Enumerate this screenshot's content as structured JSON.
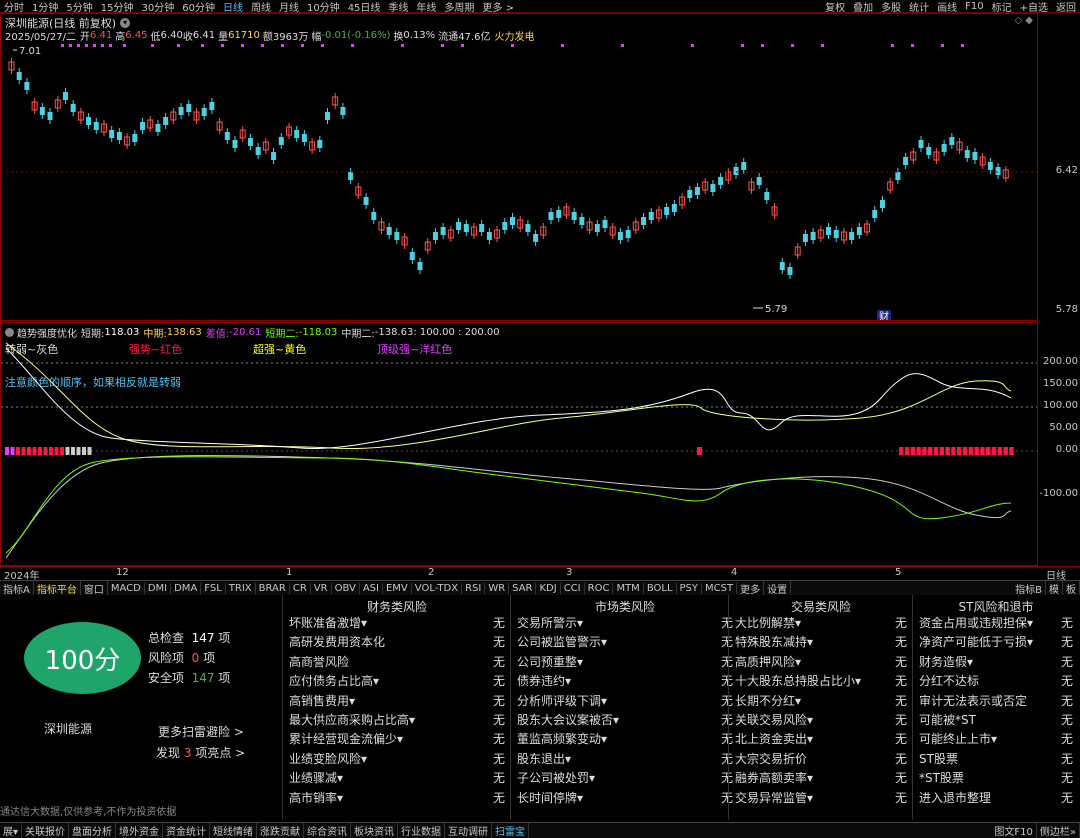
{
  "toolbar": {
    "periods": [
      "分时",
      "1分钟",
      "5分钟",
      "15分钟",
      "30分钟",
      "60分钟",
      "日线",
      "周线",
      "月线",
      "10分钟",
      "45日线",
      "季线",
      "年线",
      "多周期",
      "更多 >"
    ],
    "active_period": "日线",
    "right_items": [
      "复权",
      "叠加",
      "多股",
      "统计",
      "画线",
      "F10",
      "标记",
      "+自选",
      "返回"
    ]
  },
  "header": {
    "title": "深圳能源(日线 前复权)",
    "date": "2025/05/27/二",
    "open_label": "开",
    "open": "6.41",
    "high_label": "高",
    "high": "6.45",
    "low_label": "低",
    "low": "6.40",
    "close_label": "收",
    "close": "6.41",
    "vol_label": "量",
    "vol": "61710",
    "amt_label": "额",
    "amt": "3963万",
    "chg_label": "幅",
    "chg": "-0.01(-0.16%)",
    "turn_label": "换",
    "turn": "0.13%",
    "float_label": "流通",
    "float": "47.6亿",
    "concept": "火力发电"
  },
  "price_axis": {
    "high": "7.01",
    "mid": "6.42",
    "low": "5.78",
    "min_marker": "5.79",
    "fin_marker": "财"
  },
  "indicator": {
    "name": "趋势强度优化",
    "short_label": "短期:",
    "short": "118.03",
    "mid_label": "中期:",
    "mid": "138.63",
    "diff_label": "差值:",
    "diff": "-20.61",
    "short2_label": "短期二:",
    "short2": "-118.03",
    "mid2_label": "中期二:",
    "mid2": "-138.63",
    "refs": ": 100.00 : 200.00",
    "legend": [
      "转弱~灰色",
      "强势~红色",
      "超强~黄色",
      "顶级强~洋红色"
    ],
    "note": "注意颜色的顺序，如果相反就是转弱",
    "axis": [
      "200.00",
      "150.00",
      "100.00",
      "50.00",
      "0.00",
      "-100.00"
    ]
  },
  "time_axis": [
    "2024年",
    "12",
    "1",
    "2",
    "3",
    "4",
    "5"
  ],
  "time_axis_right": "日线",
  "tabs": [
    "指标A",
    "指标平台",
    "窗口",
    "MACD",
    "DMI",
    "DMA",
    "FSL",
    "TRIX",
    "BRAR",
    "CR",
    "VR",
    "OBV",
    "ASI",
    "EMV",
    "VOL-TDX",
    "RSI",
    "WR",
    "SAR",
    "KDJ",
    "CCI",
    "ROC",
    "MTM",
    "BOLL",
    "PSY",
    "MCST",
    "更多",
    "设置"
  ],
  "tabs_right": [
    "指标B",
    "模",
    "板"
  ],
  "risk": {
    "score": "100分",
    "stock": "深圳能源",
    "total_label": "总检查",
    "total": "147",
    "unit": "项",
    "risk_label": "风险项",
    "risk": "0",
    "safe_label": "安全项",
    "safe": "147",
    "more": "更多扫雷避险 >",
    "found_prefix": "发现",
    "found": "3",
    "found_suffix": "项亮点 >",
    "disclaimer": "通达信大数据,仅供参考,不作为投资依据",
    "categories": [
      {
        "title": "财务类风险",
        "items": [
          "坏账准备激增▾",
          "高研发费用资本化",
          "高商誉风险",
          "应付债务占比高▾",
          "高销售费用▾",
          "最大供应商采购占比高▾",
          "累计经营现金流偏少▾",
          "业绩变脸风险▾",
          "业绩骤减▾",
          "高市销率▾"
        ]
      },
      {
        "title": "市场类风险",
        "items": [
          "交易所警示▾",
          "公司被监管警示▾",
          "公司预重整▾",
          "债券违约▾",
          "分析师评级下调▾",
          "股东大会议案被否▾",
          "董监高频繁变动▾",
          "股东退出▾",
          "子公司被处罚▾",
          "长时间停牌▾"
        ]
      },
      {
        "title": "交易类风险",
        "items": [
          "大比例解禁▾",
          "特殊股东减持▾",
          "高质押风险▾",
          "十大股东总持股占比小▾",
          "长期不分红▾",
          "关联交易风险▾",
          "北上资金卖出▾",
          "大宗交易折价",
          "融券高额卖率▾",
          "交易异常监管▾"
        ]
      },
      {
        "title": "ST风险和退市",
        "items": [
          "资金占用或违规担保▾",
          "净资产可能低于亏损▾",
          "财务造假▾",
          "分红不达标",
          "审计无法表示或否定",
          "可能被*ST",
          "可能终止上市▾",
          "ST股票",
          "*ST股票",
          "进入退市整理"
        ]
      }
    ],
    "none": "无"
  },
  "bottom_tabs": [
    "展▾",
    "关联报价",
    "盘面分析",
    "境外资金",
    "资金统计",
    "短线情绪",
    "涨跌贡献",
    "综合资讯",
    "板块资讯",
    "行业数据",
    "互动调研",
    "扫雷宝"
  ],
  "bottom_right": [
    "图文F10",
    "侧边栏»"
  ]
}
